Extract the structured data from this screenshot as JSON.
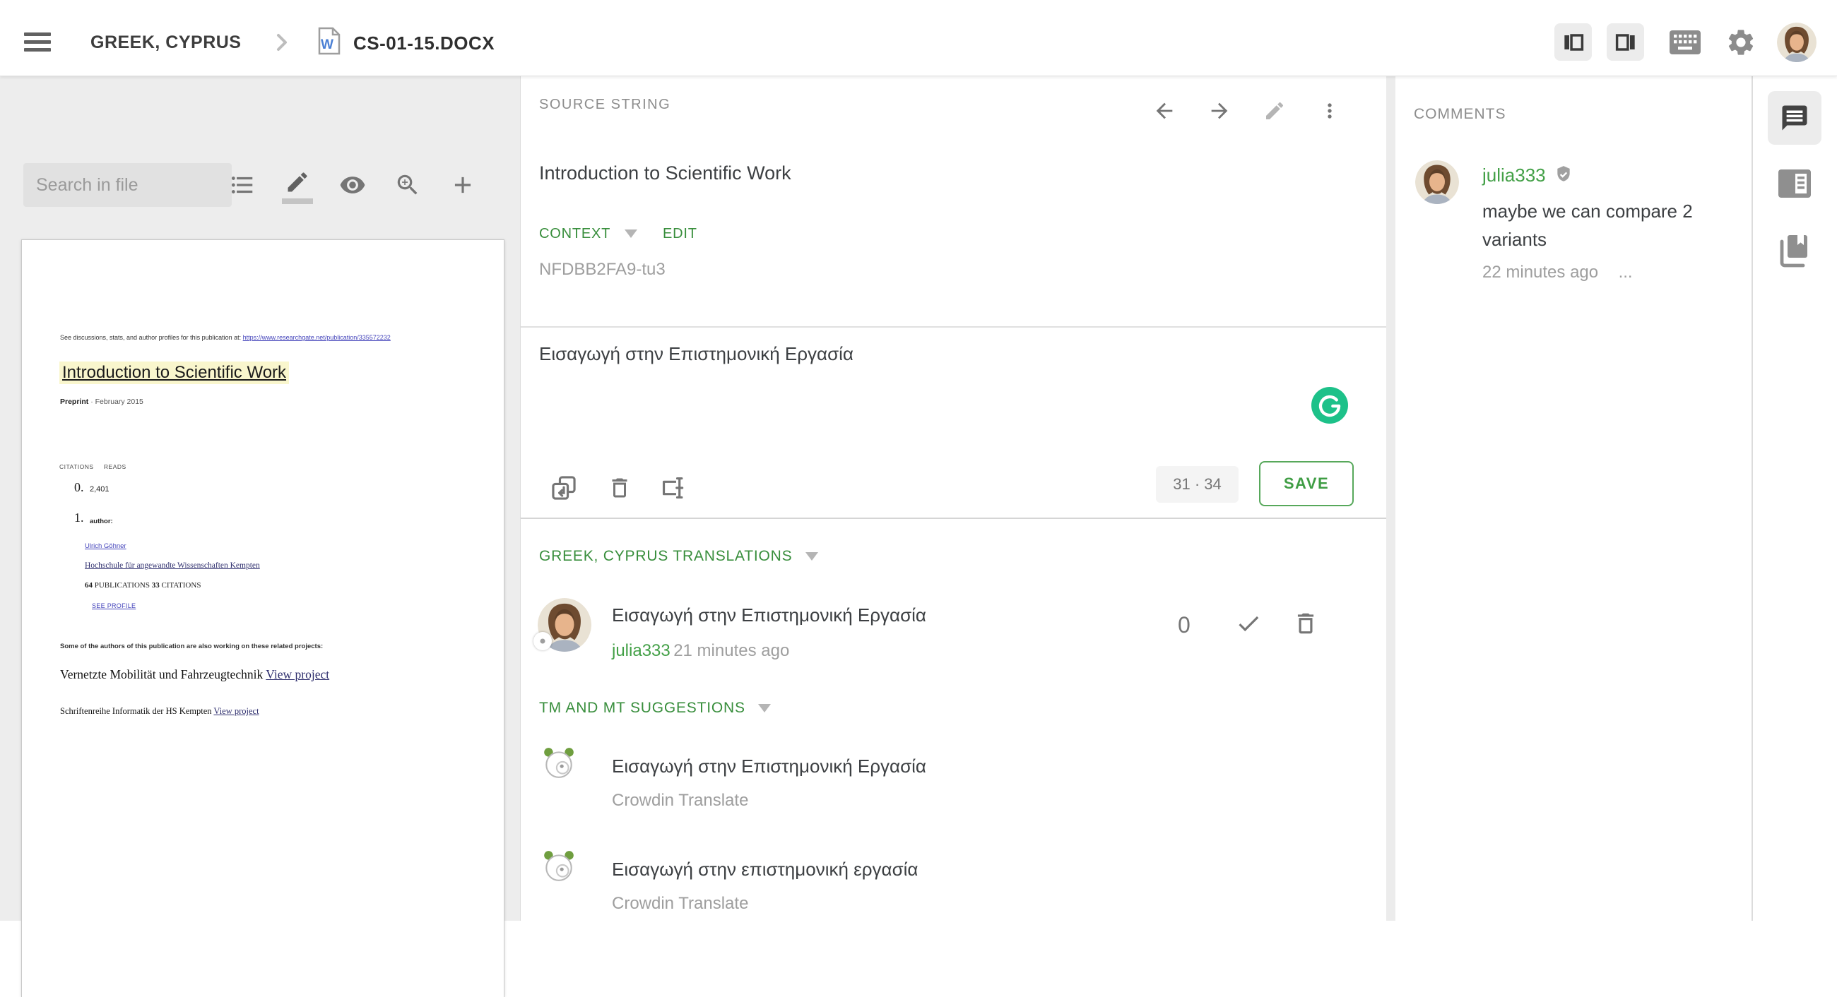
{
  "topbar": {
    "breadcrumb_project": "GREEK, CYPRUS",
    "file_name": "CS-01-15.DOCX"
  },
  "left_panel": {
    "search_placeholder": "Search in file",
    "document": {
      "preface": "See discussions, stats, and author profiles for this publication at:",
      "preface_link": "https://www.researchgate.net/publication/335572232",
      "title": "Introduction to Scientific Work",
      "preprint_label": "Preprint",
      "preprint_date": "· February 2015",
      "stats_citations_label": "CITATIONS",
      "stats_reads_label": "READS",
      "citations_list_number": "0.",
      "reads_value": "2,401",
      "author_list_number": "1.",
      "author_label": "author:",
      "author_name": "Ulrich Göhner",
      "author_affiliation": "Hochschule für angewandte Wissenschaften Kempten",
      "pubs_count": "64",
      "pubs_label": "PUBLICATIONS",
      "cit_count": "33",
      "cit_label": "CITATIONS",
      "see_profile": "SEE PROFILE",
      "related_note": "Some of the authors of this publication are also working on these related projects:",
      "project1_title": "Vernetzte Mobilität und Fahrzeugtechnik",
      "project1_link": "View project",
      "project2_title": "Schriftenreihe Informatik der HS Kempten",
      "project2_link": "View project"
    }
  },
  "source_panel": {
    "header": "SOURCE STRING",
    "source_text": "Introduction to Scientific Work",
    "context_label": "CONTEXT",
    "edit_label": "EDIT",
    "context_value": "NFDBB2FA9-tu3"
  },
  "editor": {
    "translation_text": "Εισαγωγή στην Επιστημονική Εργασία",
    "counter": "31 · 34",
    "save_label": "SAVE"
  },
  "translations": {
    "header": "GREEK, CYPRUS TRANSLATIONS",
    "items": [
      {
        "text": "Εισαγωγή στην Επιστημονική Εργασία",
        "author": "julia333",
        "time": "21 minutes ago",
        "votes": "0"
      }
    ]
  },
  "suggestions": {
    "header": "TM AND MT SUGGESTIONS",
    "items": [
      {
        "text": "Εισαγωγή στην Επιστημονική Εργασία",
        "source": "Crowdin Translate"
      },
      {
        "text": "Εισαγωγή στην επιστημονική εργασία",
        "source": "Crowdin Translate"
      }
    ]
  },
  "comments": {
    "header": "COMMENTS",
    "items": [
      {
        "author": "julia333",
        "text": "maybe we can compare 2 variants",
        "time": "22 minutes ago",
        "more": "..."
      }
    ]
  },
  "colors": {
    "accent_green": "#388e3c",
    "save_green": "#43a047",
    "grammarly_green": "#1dc189",
    "word_blue": "#4a7fd4",
    "panel_gray": "#ededed"
  }
}
